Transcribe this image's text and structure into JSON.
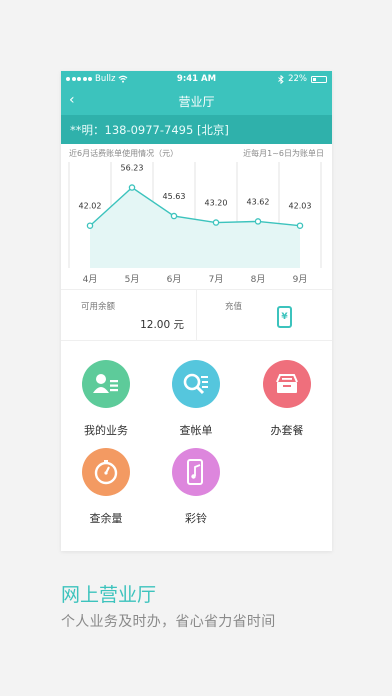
{
  "status_bar": {
    "carrier": "Bullz",
    "time": "9:41 AM",
    "battery": "22%"
  },
  "nav": {
    "title": "营业厅"
  },
  "account": {
    "line": "**明：138-0977-7495 [北京]"
  },
  "chart_header": {
    "left": "近6月话费账单使用情况（元）",
    "right": "近每月1~6日为账单日"
  },
  "chart_data": {
    "type": "area",
    "categories": [
      "4月",
      "5月",
      "6月",
      "7月",
      "8月",
      "9月"
    ],
    "values": [
      42.02,
      56.23,
      45.63,
      43.2,
      43.62,
      42.03
    ],
    "value_labels": [
      "42.02",
      "56.23",
      "45.63",
      "43.20",
      "43.62",
      "42.03"
    ],
    "title": "近6月话费账单使用情况（元）",
    "grid": true,
    "colors": {
      "line": "#3cc3bd",
      "fill": "#e4f6f5"
    }
  },
  "balance": {
    "label": "可用余额",
    "value": "12.00 元",
    "recharge_label": "充值",
    "recharge_icon": "¥"
  },
  "services": [
    {
      "label": "我的业务",
      "icon": "user-card-icon",
      "color": "#5dcb9a"
    },
    {
      "label": "查帐单",
      "icon": "search-list-icon",
      "color": "#55c6dd"
    },
    {
      "label": "办套餐",
      "icon": "tray-icon",
      "color": "#ef6f7c"
    },
    {
      "label": "查余量",
      "icon": "clock-icon",
      "color": "#f39a62"
    },
    {
      "label": "彩铃",
      "icon": "music-phone-icon",
      "color": "#dd86dd"
    }
  ],
  "footer": {
    "title": "网上营业厅",
    "subtitle": "个人业务及时办，省心省力省时间"
  }
}
